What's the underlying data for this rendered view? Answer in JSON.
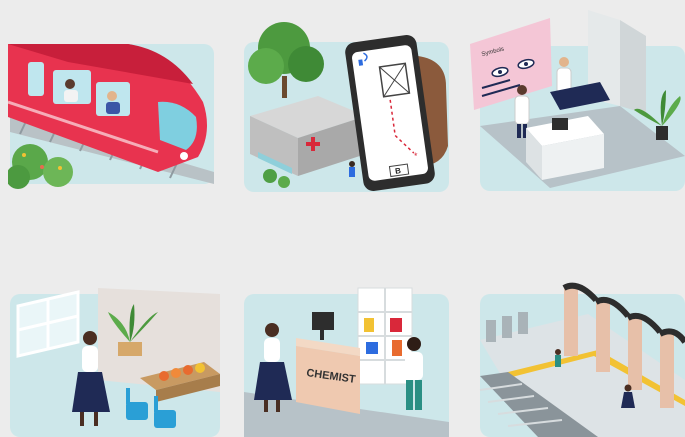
{
  "tiles": [
    {
      "icon": "train-icon"
    },
    {
      "icon": "hospital-navigation-icon",
      "phone_marker": "B"
    },
    {
      "icon": "eye-clinic-icon",
      "screen_label": "Symbols"
    },
    {
      "icon": "waiting-room-icon"
    },
    {
      "icon": "pharmacy-icon",
      "counter_label": "CHEMIST"
    },
    {
      "icon": "train-station-icon"
    }
  ],
  "colors": {
    "background": "#ececec",
    "tile_bg": "#cde7ea",
    "train": "#e8334f",
    "accent_red": "#d9283a",
    "navy": "#1f2a55"
  }
}
